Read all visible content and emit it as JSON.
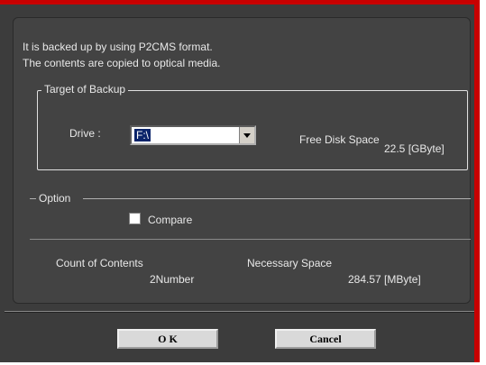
{
  "intro": {
    "line1": "It is backed up by using  P2CMS format.",
    "line2": "The contents are copied to optical media."
  },
  "target": {
    "legend": "Target of Backup",
    "drive_label": "Drive  :",
    "drive_value": "F:\\",
    "free_space_label": "Free Disk Space",
    "free_space_value": "22.5 [GByte]"
  },
  "option": {
    "legend": "Option",
    "compare_label": "Compare",
    "compare_checked": false
  },
  "summary": {
    "count_label": "Count of Contents",
    "count_value": "2Number",
    "necessary_label": "Necessary Space",
    "necessary_value": "284.57 [MByte]"
  },
  "buttons": {
    "ok_label": "O K",
    "cancel_label": "Cancel"
  },
  "icons": {
    "dropdown": "chevron-down-icon",
    "checkbox": "checkbox-icon"
  },
  "colors": {
    "window_frame": "#c80000",
    "background": "#3c3c3c",
    "panel": "#434343",
    "selection": "#0a246a"
  }
}
